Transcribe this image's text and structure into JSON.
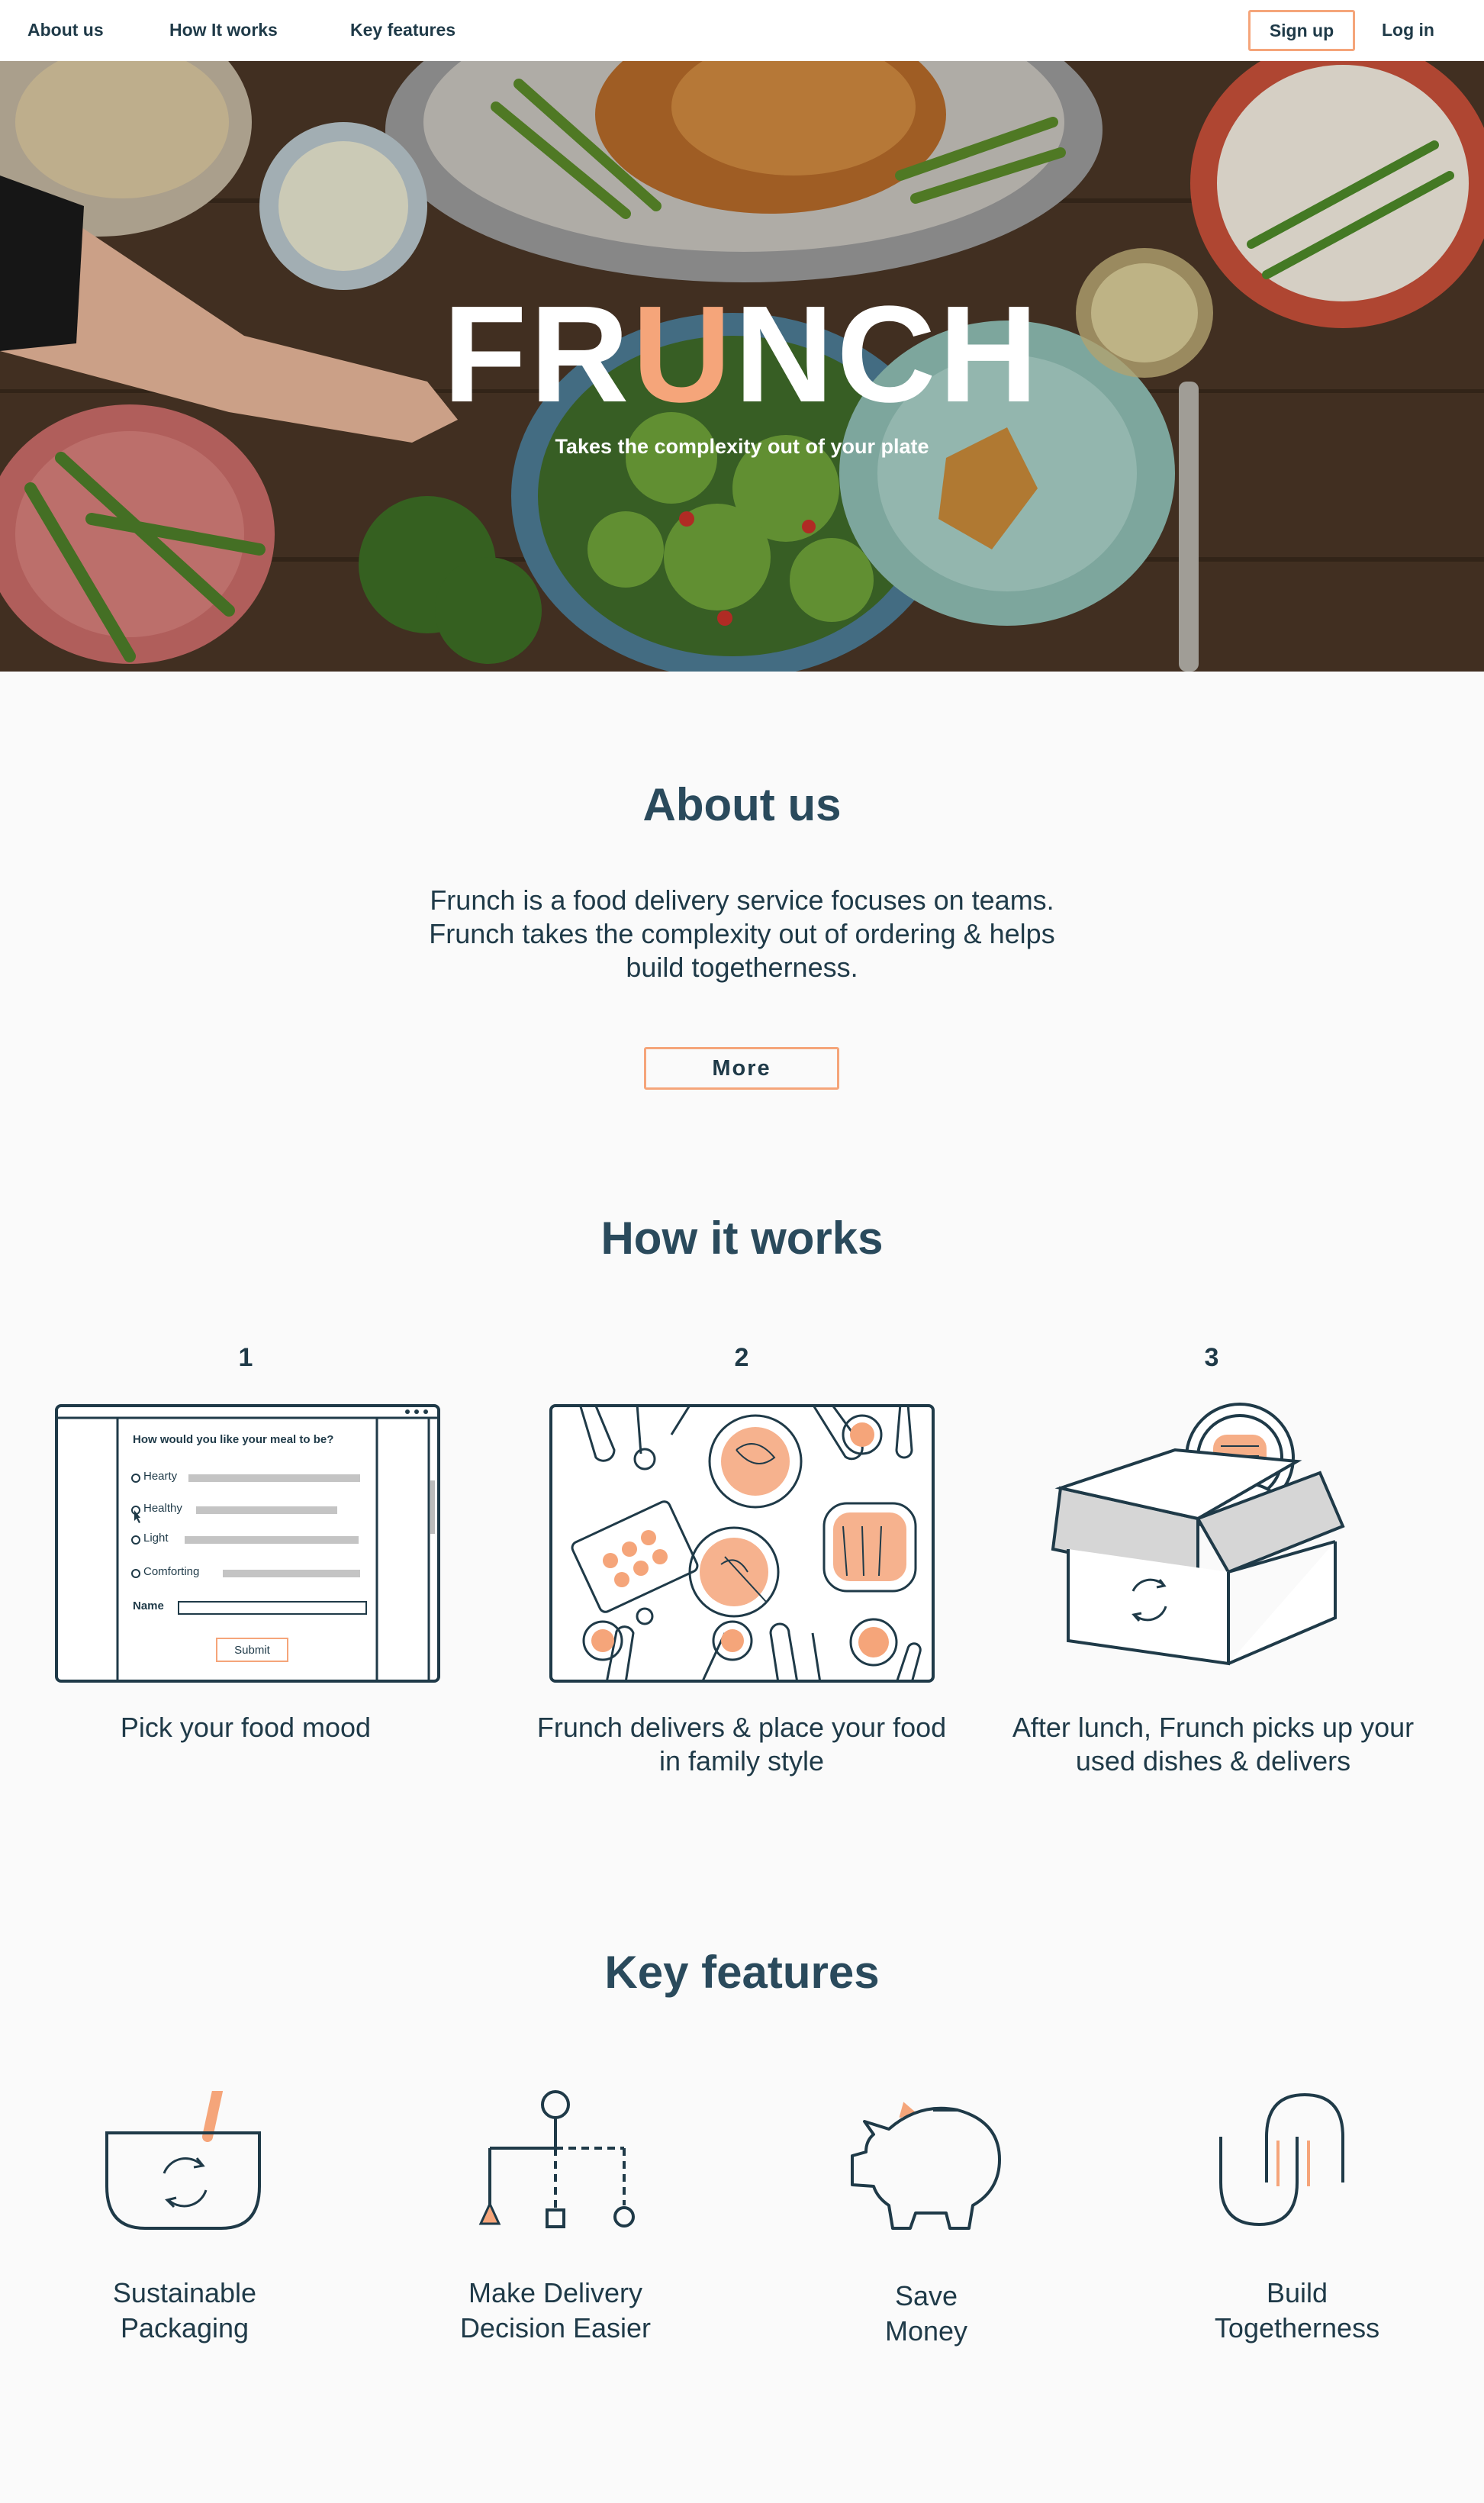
{
  "nav": {
    "about": "About us",
    "how": "How It works",
    "features": "Key features",
    "signup": "Sign up",
    "login": "Log in"
  },
  "hero": {
    "title_part1": "FR",
    "title_accent": "U",
    "title_part2": "NCH",
    "tagline": "Takes the complexity out of your plate"
  },
  "about": {
    "title": "About us",
    "text": "Frunch is a food delivery service focuses on teams. Frunch takes the complexity out of ordering & helps build togetherness.",
    "more": "More"
  },
  "how": {
    "title": "How it works",
    "steps": [
      {
        "num": "1",
        "caption": "Pick your food mood"
      },
      {
        "num": "2",
        "caption": "Frunch delivers & place your food in family style"
      },
      {
        "num": "3",
        "caption": "After lunch, Frunch picks up your used dishes & delivers"
      }
    ],
    "form": {
      "question": "How would you like your meal to be?",
      "options": [
        "Hearty",
        "Healthy",
        "Light",
        "Comforting"
      ],
      "name_label": "Name",
      "submit": "Submit"
    }
  },
  "features": {
    "title": "Key features",
    "items": [
      {
        "line1": "Sustainable",
        "line2": "Packaging",
        "icon": "bowl-recycle-icon"
      },
      {
        "line1": "Make Delivery",
        "line2": "Decision Easier",
        "icon": "decision-tree-icon"
      },
      {
        "line1": "Save",
        "line2": "Money",
        "icon": "piggy-bank-icon"
      },
      {
        "line1": "Build",
        "line2": "Togetherness",
        "icon": "togetherness-icon"
      }
    ]
  },
  "colors": {
    "accent": "#f5a57a",
    "navy": "#1f3a48",
    "heading": "#2a4a5c",
    "background": "#fafafa"
  }
}
